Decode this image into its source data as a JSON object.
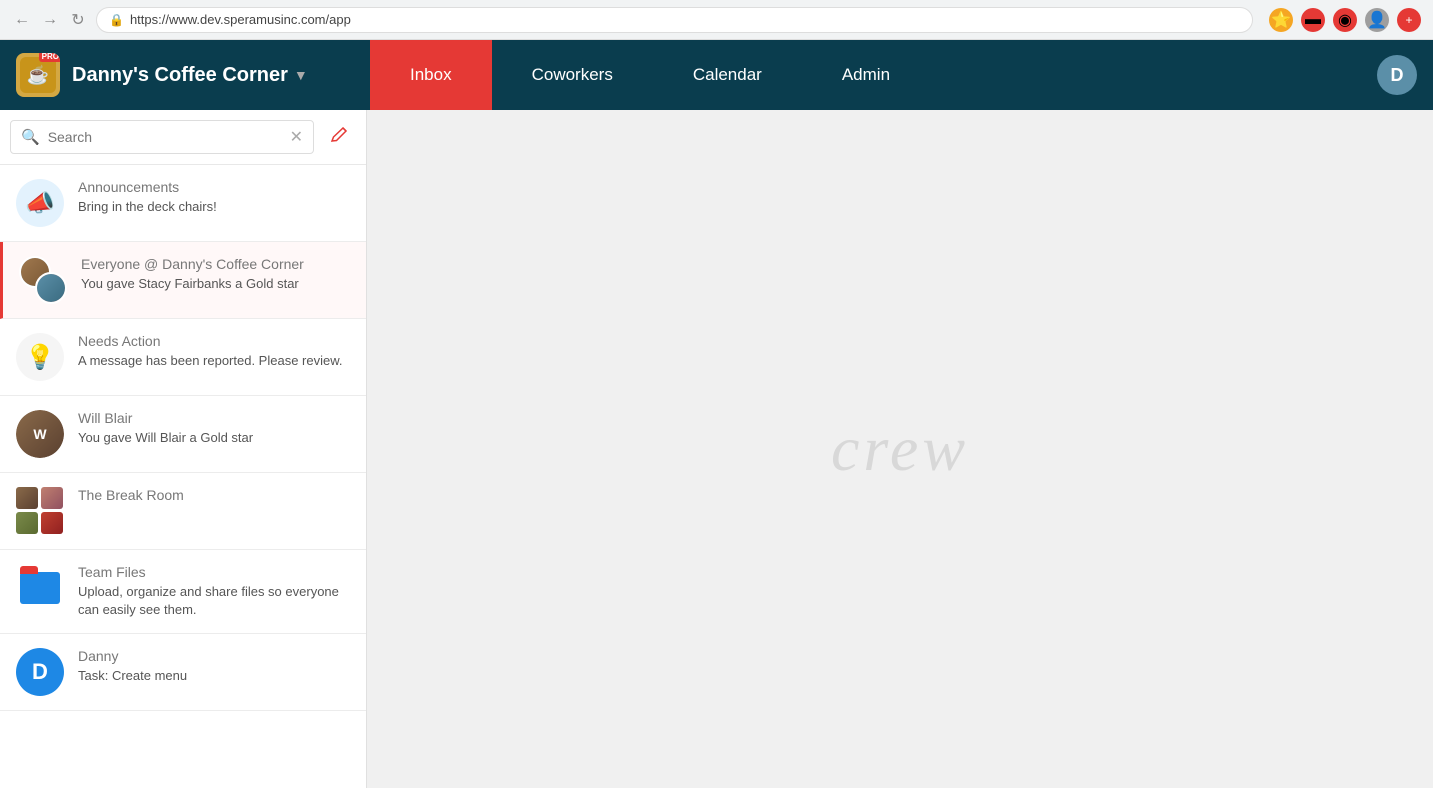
{
  "browser": {
    "url": "https://www.dev.speramusinc.com/app",
    "back_label": "←",
    "forward_label": "→",
    "reload_label": "↻"
  },
  "header": {
    "brand_name": "Danny's Coffee Corner",
    "brand_badge": "PRO",
    "dropdown_label": "▾",
    "nav_items": [
      {
        "id": "inbox",
        "label": "Inbox",
        "active": true
      },
      {
        "id": "coworkers",
        "label": "Coworkers",
        "active": false
      },
      {
        "id": "calendar",
        "label": "Calendar",
        "active": false
      },
      {
        "id": "admin",
        "label": "Admin",
        "active": false
      }
    ],
    "user_initial": "D"
  },
  "sidebar": {
    "search_placeholder": "Search",
    "compose_icon": "✏",
    "items": [
      {
        "id": "announcements",
        "name": "Announcements",
        "preview": "Bring in the deck chairs!",
        "avatar_type": "megaphone",
        "selected": false
      },
      {
        "id": "everyone",
        "name": "Everyone @ Danny's Coffee Corner",
        "preview": "You gave Stacy Fairbanks a Gold star",
        "avatar_type": "double_faces",
        "selected": true
      },
      {
        "id": "needs_action",
        "name": "Needs Action",
        "preview": "A message has been reported. Please review.",
        "avatar_type": "lightbulb",
        "selected": false
      },
      {
        "id": "will_blair",
        "name": "Will Blair",
        "preview": "You gave Will Blair a Gold star",
        "avatar_type": "face_will",
        "selected": false
      },
      {
        "id": "break_room",
        "name": "The Break Room",
        "preview": "",
        "avatar_type": "quad_faces",
        "selected": false
      },
      {
        "id": "team_files",
        "name": "Team Files",
        "preview": "Upload, organize and share files so everyone can easily see them.",
        "avatar_type": "folder",
        "selected": false
      },
      {
        "id": "danny",
        "name": "Danny",
        "preview": "Task: Create menu",
        "avatar_type": "danny",
        "selected": false
      }
    ]
  },
  "main": {
    "watermark": "crew"
  }
}
